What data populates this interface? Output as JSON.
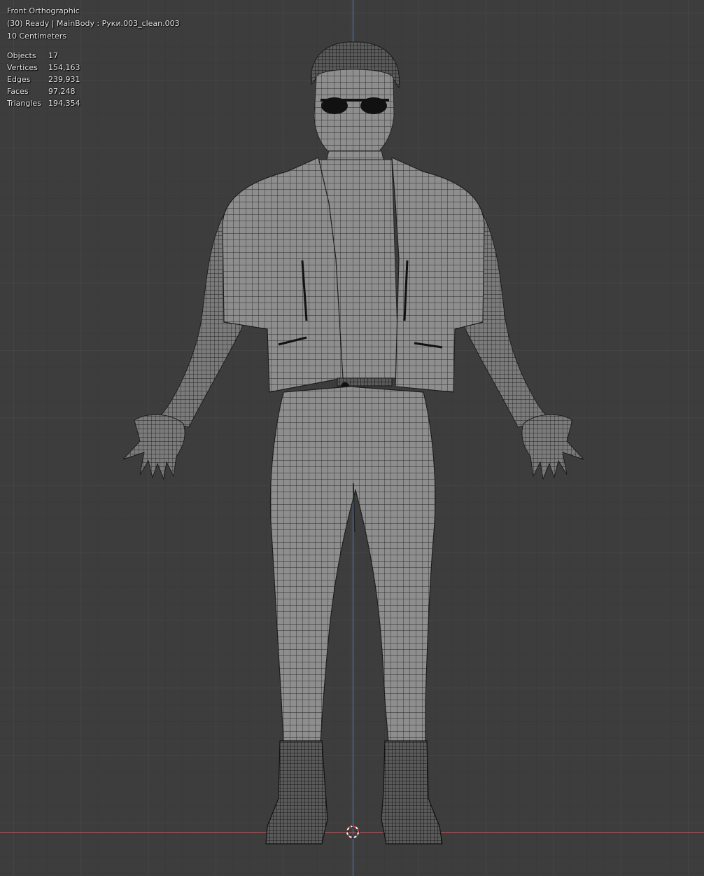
{
  "viewport": {
    "view_name": "Front Orthographic",
    "status_line": "(30) Ready | MainBody : Руки.003_clean.003",
    "grid_scale": "10 Centimeters",
    "colors": {
      "background": "#3d3d3d",
      "grid": "#474747",
      "z_axis": "#4f7fc2",
      "x_axis": "#b4545a",
      "mesh": "#8f8f8f"
    }
  },
  "stats": [
    {
      "label": "Objects",
      "value": "17"
    },
    {
      "label": "Vertices",
      "value": "154,163"
    },
    {
      "label": "Edges",
      "value": "239,931"
    },
    {
      "label": "Faces",
      "value": "97,248"
    },
    {
      "label": "Triangles",
      "value": "194,354"
    }
  ],
  "icons": {
    "cursor": "3d-cursor-icon"
  }
}
